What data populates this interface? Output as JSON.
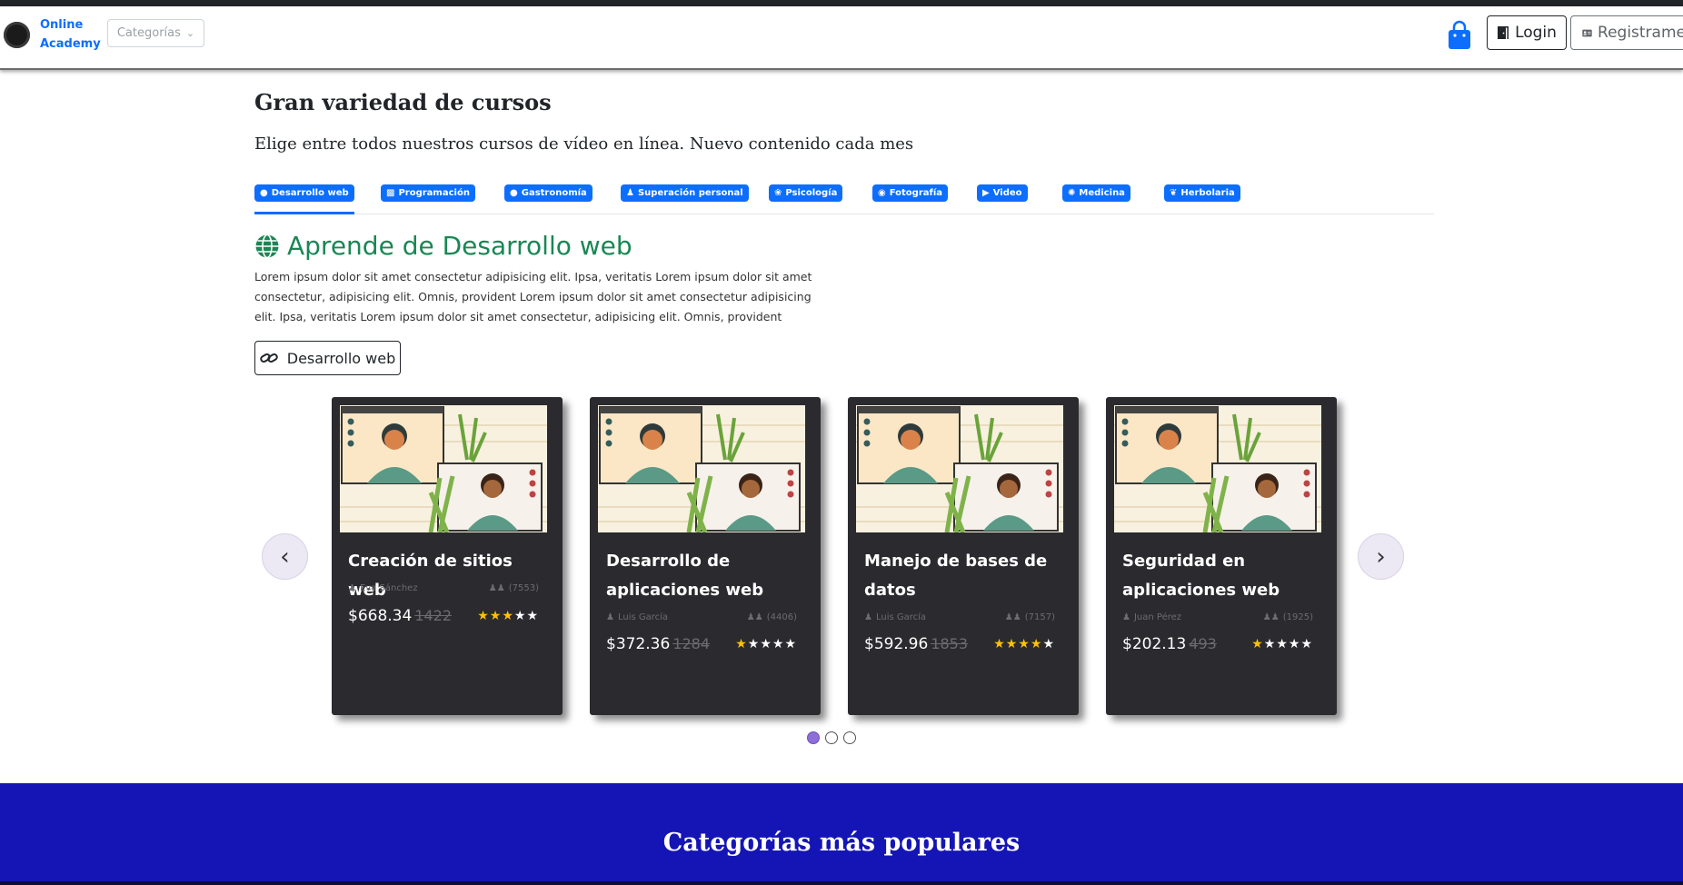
{
  "nav": {
    "brand": "Online Academy",
    "categories_label": "Categorías",
    "login_label": "Login",
    "register_label": "Registrame"
  },
  "section": {
    "title": "Gran variedad de cursos",
    "subtitle": "Elige entre todos nuestros cursos de vídeo en línea. Nuevo contenido cada mes"
  },
  "tabs": [
    {
      "label": "Desarrollo web",
      "icon": "globe-icon",
      "active": true
    },
    {
      "label": "Programación",
      "icon": "monitor-icon",
      "active": false
    },
    {
      "label": "Gastronomía",
      "icon": "food-icon",
      "active": false
    },
    {
      "label": "Superación personal",
      "icon": "user-icon",
      "active": false
    },
    {
      "label": "Psicología",
      "icon": "brain-icon",
      "active": false
    },
    {
      "label": "Fotografía",
      "icon": "camera-icon",
      "active": false
    },
    {
      "label": "Video",
      "icon": "video-icon",
      "active": false
    },
    {
      "label": "Medicina",
      "icon": "virus-icon",
      "active": false
    },
    {
      "label": "Herbolaria",
      "icon": "leaf-icon",
      "active": false
    }
  ],
  "learn": {
    "title": "Aprende de Desarrollo web",
    "description": "Lorem ipsum dolor sit amet consectetur adipisicing elit. Ipsa, veritatis Lorem ipsum dolor sit amet consectetur, adipisicing elit. Omnis, provident Lorem ipsum dolor sit amet consectetur adipisicing elit. Ipsa, veritatis Lorem ipsum dolor sit amet consectetur, adipisicing elit. Omnis, provident",
    "link_label": "Desarrollo web"
  },
  "courses": [
    {
      "title": "Creación de sitios web",
      "instructor": "Eva Sánchez",
      "students": "(7553)",
      "price": "$668.34",
      "old_price": "1422",
      "rating": 3
    },
    {
      "title": "Desarrollo de aplicaciones web",
      "instructor": "Luis García",
      "students": "(4406)",
      "price": "$372.36",
      "old_price": "1284",
      "rating": 1
    },
    {
      "title": "Manejo de bases de datos",
      "instructor": "Luis García",
      "students": "(7157)",
      "price": "$592.96",
      "old_price": "1853",
      "rating": 4
    },
    {
      "title": "Seguridad en aplicaciones web",
      "instructor": "Juan Pérez",
      "students": "(1925)",
      "price": "$202.13",
      "old_price": "493",
      "rating": 1
    }
  ],
  "carousel": {
    "prev": "‹",
    "next": "›",
    "pages": 3,
    "active_page": 1
  },
  "popular": {
    "title": "Categorías más populares"
  },
  "colors": {
    "primary": "#0d6efd",
    "success": "#198754",
    "card_bg": "#2b2a2e",
    "band": "#1515b5",
    "star": "#ffc107"
  }
}
